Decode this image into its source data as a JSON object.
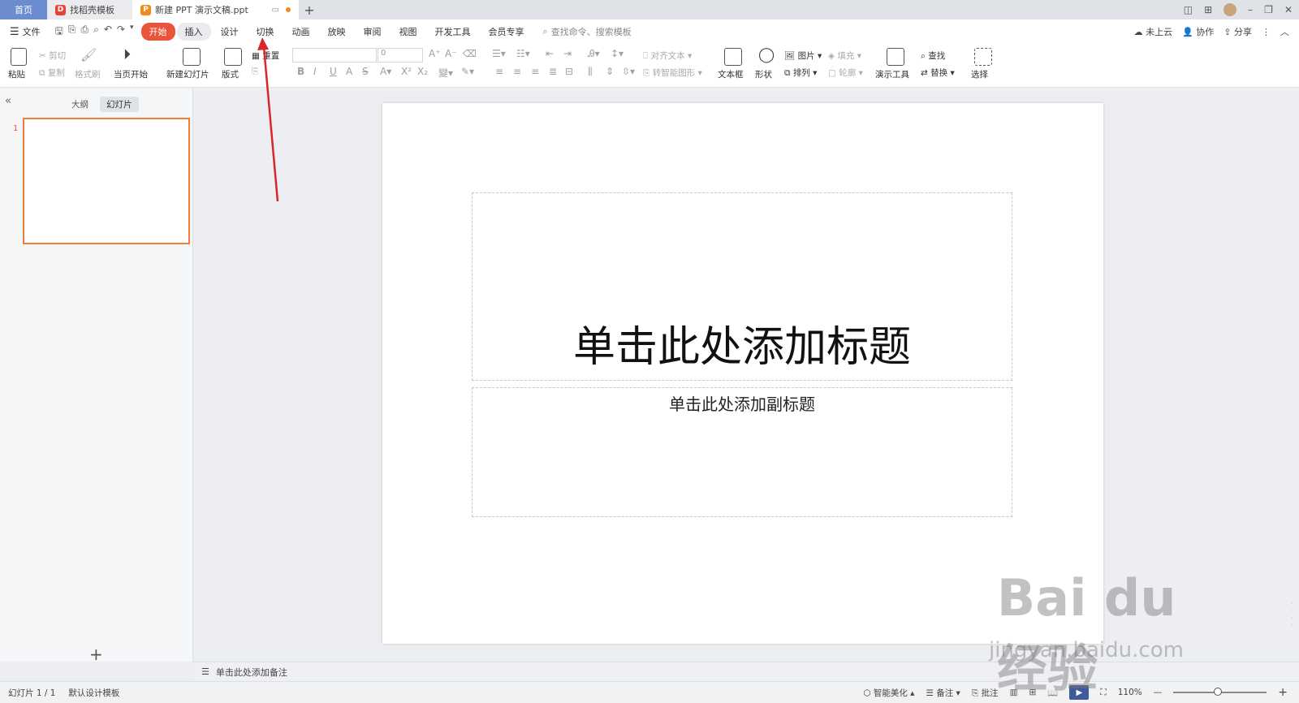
{
  "tabs": {
    "home": "首页",
    "template": "找稻壳模板",
    "document": "新建 PPT 演示文稿.ppt",
    "new_tab": "+"
  },
  "window": {
    "minimize": "–",
    "restore": "❐",
    "close": "✕"
  },
  "menu": {
    "file": "文件",
    "items": [
      "开始",
      "插入",
      "设计",
      "切换",
      "动画",
      "放映",
      "审阅",
      "视图",
      "开发工具",
      "会员专享"
    ],
    "active_index": 0,
    "search_placeholder": "查找命令、搜索模板",
    "right": {
      "cloud": "未上云",
      "collab": "协作",
      "share": "分享"
    }
  },
  "ribbon": {
    "paste": "粘贴",
    "cut": "剪切",
    "copy": "复制",
    "format_painter": "格式刷",
    "from_current": "当页开始",
    "new_slide": "新建幻灯片",
    "layout": "版式",
    "reset": "重置",
    "font_size": "0",
    "align_text": "对齐文本",
    "smart_art": "转智能图形",
    "text_box": "文本框",
    "shape": "形状",
    "picture": "图片",
    "arrange": "排列",
    "fill": "填充",
    "outline": "轮廓",
    "presenter_tools": "演示工具",
    "find": "查找",
    "replace": "替换",
    "select": "选择"
  },
  "left_panel": {
    "tabs": [
      "大纲",
      "幻灯片"
    ],
    "selected_tab": 1,
    "slide_number": "1",
    "collapse": "«",
    "add": "+"
  },
  "slide": {
    "title_placeholder": "单击此处添加标题",
    "subtitle_placeholder": "单击此处添加副标题"
  },
  "notes": {
    "placeholder": "单击此处添加备注"
  },
  "status": {
    "slide_count": "幻灯片 1 / 1",
    "theme": "默认设计模板",
    "beautify": "智能美化",
    "notes": "备注",
    "comments": "批注",
    "zoom": "110%",
    "zoom_level": 0.5
  },
  "watermark": {
    "logo": "Bai du 经验",
    "url": "jingyan.baidu.com"
  },
  "colors": {
    "accent": "#e8553a",
    "thumb_border": "#f07d3a",
    "annotation": "#d9262b",
    "home_tab": "#6b8ccf"
  }
}
